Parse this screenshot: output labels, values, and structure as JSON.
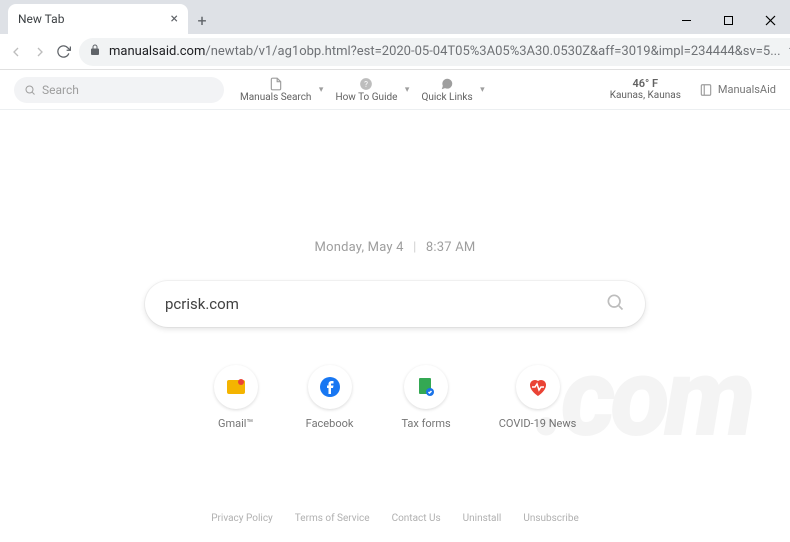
{
  "browser": {
    "tab_title": "New Tab",
    "url_host": "manualsaid.com",
    "url_path": "/newtab/v1/ag1obp.html?est=2020-05-04T05%3A05%3A30.0530Z&aff=3019&impl=234444&sv=5..."
  },
  "extbar": {
    "search_placeholder": "Search",
    "menu": [
      {
        "label": "Manuals Search"
      },
      {
        "label": "How To Guide"
      },
      {
        "label": "Quick Links"
      }
    ],
    "weather_temp": "46° F",
    "weather_loc": "Kaunas, Kaunas",
    "brand": "ManualsAid"
  },
  "page": {
    "date": "Monday, May 4",
    "time": "8:37 AM",
    "search_value": "pcrisk.com"
  },
  "tiles": [
    {
      "label": "Gmail™",
      "color": "#f4b400",
      "accent": "#ea4335"
    },
    {
      "label": "Facebook",
      "color": "#1877f2"
    },
    {
      "label": "Tax forms",
      "color": "#34a853"
    },
    {
      "label": "COVID-19 News",
      "color": "#ea4335"
    }
  ],
  "footer": [
    "Privacy Policy",
    "Terms of Service",
    "Contact Us",
    "Uninstall",
    "Unsubscribe"
  ]
}
